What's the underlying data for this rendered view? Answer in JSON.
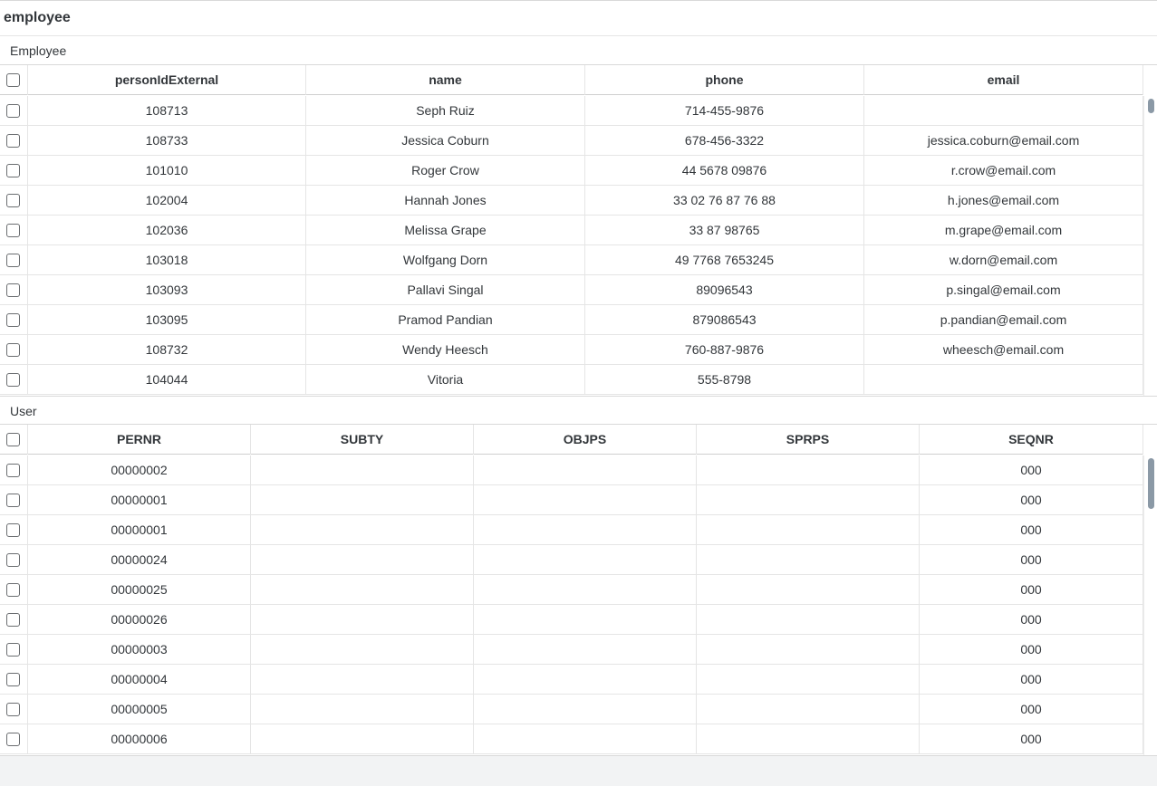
{
  "window": {
    "title": "employee"
  },
  "employee_section": {
    "label": "Employee",
    "columns": [
      "personIdExternal",
      "name",
      "phone",
      "email"
    ],
    "rows": [
      [
        "108713",
        "Seph Ruiz",
        "714-455-9876",
        ""
      ],
      [
        "108733",
        "Jessica Coburn",
        "678-456-3322",
        "jessica.coburn@email.com"
      ],
      [
        "101010",
        "Roger Crow",
        "44 5678 09876",
        "r.crow@email.com"
      ],
      [
        "102004",
        "Hannah Jones",
        "33 02 76 87 76 88",
        "h.jones@email.com"
      ],
      [
        "102036",
        "Melissa Grape",
        "33 87 98765",
        "m.grape@email.com"
      ],
      [
        "103018",
        "Wolfgang Dorn",
        "49 7768 7653245",
        "w.dorn@email.com"
      ],
      [
        "103093",
        "Pallavi Singal",
        "89096543",
        "p.singal@email.com"
      ],
      [
        "103095",
        "Pramod Pandian",
        "879086543",
        "p.pandian@email.com"
      ],
      [
        "108732",
        "Wendy Heesch",
        "760-887-9876",
        "wheesch@email.com"
      ],
      [
        "104044",
        "Vitoria",
        "555-8798",
        ""
      ]
    ]
  },
  "user_section": {
    "label": "User",
    "columns": [
      "PERNR",
      "SUBTY",
      "OBJPS",
      "SPRPS",
      "SEQNR"
    ],
    "rows": [
      [
        "00000002",
        "",
        "",
        "",
        "000"
      ],
      [
        "00000001",
        "",
        "",
        "",
        "000"
      ],
      [
        "00000001",
        "",
        "",
        "",
        "000"
      ],
      [
        "00000024",
        "",
        "",
        "",
        "000"
      ],
      [
        "00000025",
        "",
        "",
        "",
        "000"
      ],
      [
        "00000026",
        "",
        "",
        "",
        "000"
      ],
      [
        "00000003",
        "",
        "",
        "",
        "000"
      ],
      [
        "00000004",
        "",
        "",
        "",
        "000"
      ],
      [
        "00000005",
        "",
        "",
        "",
        "000"
      ],
      [
        "00000006",
        "",
        "",
        "",
        "000"
      ]
    ]
  }
}
